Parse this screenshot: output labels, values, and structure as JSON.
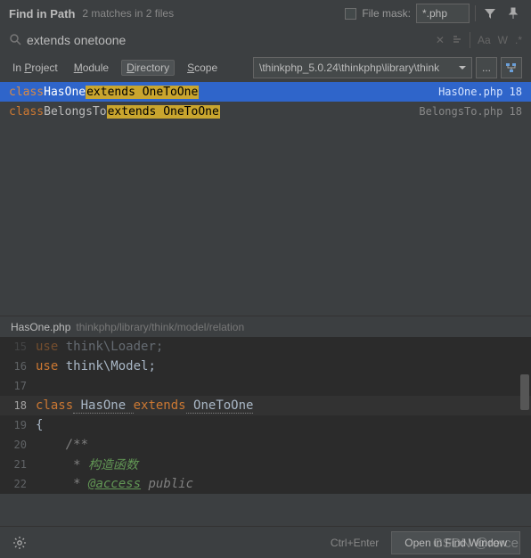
{
  "header": {
    "title": "Find in Path",
    "subtitle": "2 matches in 2 files",
    "filemask_label": "File mask:",
    "filemask_value": "*.php"
  },
  "search": {
    "query": "extends onetoone",
    "case_label": "Aa",
    "word_label": "W",
    "regex_label": ".*"
  },
  "scope": {
    "tabs": [
      {
        "label": "In Project",
        "underline": "P"
      },
      {
        "label": "Module",
        "underline": "M"
      },
      {
        "label": "Directory",
        "underline": "D"
      },
      {
        "label": "Scope",
        "underline": "S"
      }
    ],
    "active": 2,
    "path": "\\thinkphp_5.0.24\\thinkphp\\library\\think",
    "dots": "..."
  },
  "results": [
    {
      "pre_kw": "class",
      "pre_text": " HasOne ",
      "highlight": "extends OneToOne",
      "file": "HasOne.php",
      "line": "18",
      "selected": true
    },
    {
      "pre_kw": "class",
      "pre_text": " BelongsTo ",
      "highlight": "extends OneToOne",
      "file": "BelongsTo.php",
      "line": "18",
      "selected": false
    }
  ],
  "preview": {
    "file": "HasOne.php",
    "path": "thinkphp/library/think/model/relation"
  },
  "code": {
    "lines": [
      {
        "n": "15",
        "kw": "use",
        "rest": " think\\Loader;",
        "dim": true
      },
      {
        "n": "16",
        "kw": "use",
        "rest": " think\\Model;"
      },
      {
        "n": "17",
        "kw": "",
        "rest": ""
      },
      {
        "n": "18",
        "kw": "class",
        "cls": " HasOne ",
        "kw2": "extends",
        "cls2": " OneToOne",
        "hl": true
      },
      {
        "n": "19",
        "kw": "",
        "rest": "{"
      },
      {
        "n": "20",
        "comment": "    /**"
      },
      {
        "n": "21",
        "comment": "     * ",
        "zh": "构造函数"
      },
      {
        "n": "22",
        "comment": "     * ",
        "dockw": "@access",
        "docrest": " public"
      }
    ]
  },
  "footer": {
    "hint": "Ctrl+Enter",
    "open": "Open in Find Window"
  },
  "watermark": "CSDN @rerce"
}
